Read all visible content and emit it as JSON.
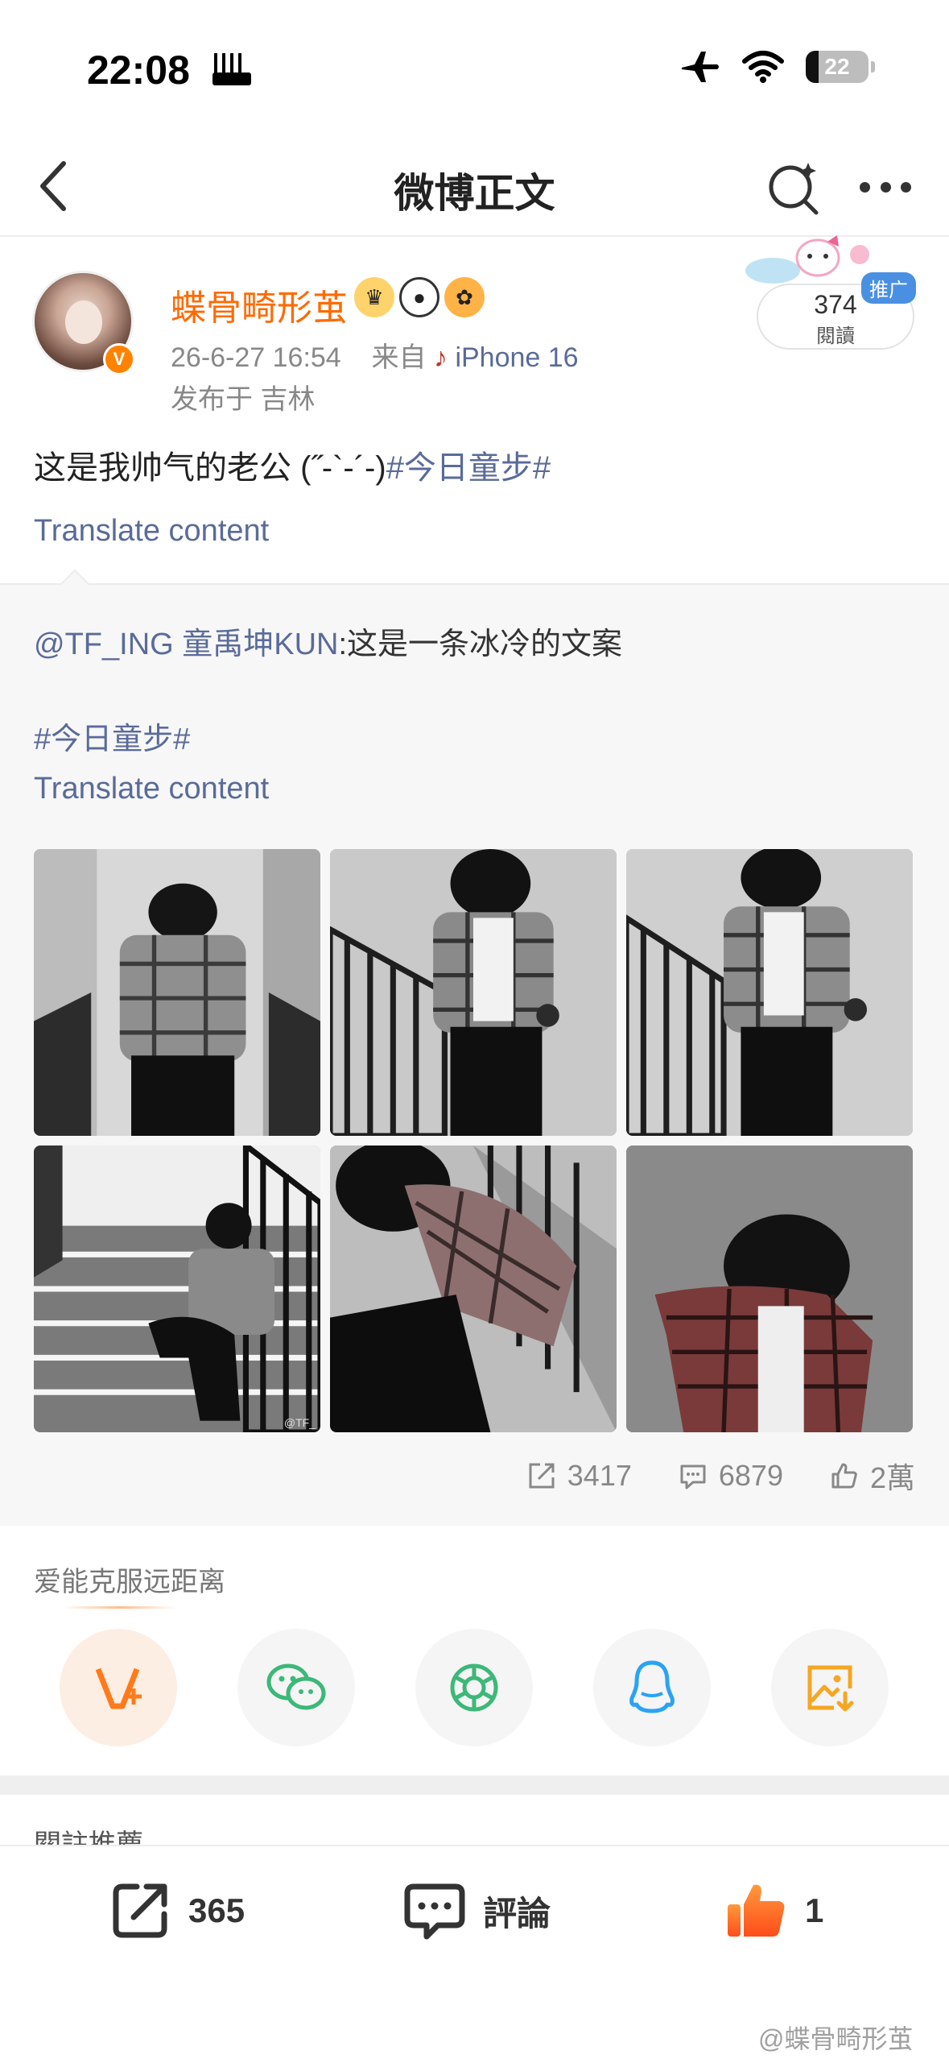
{
  "status_bar": {
    "time": "22:08",
    "battery": "22"
  },
  "nav": {
    "title": "微博正文"
  },
  "post": {
    "author": "蝶骨畸形茧",
    "date": "26-6-27 16:54",
    "source_prefix": "来自",
    "source_device": "iPhone 16",
    "location": "发布于 吉林",
    "read_count": "374",
    "read_label": "閱讀",
    "promo_tag": "推广",
    "text": "这是我帅气的老公 (˶‾᷄ ⁻̫ ‾᷅˵)",
    "text_display": "这是我帅气的老公 (˝-`-´-)",
    "hashtag": "#今日童步#",
    "translate": "Translate content"
  },
  "repost": {
    "user": "@TF_ING 童禹坤KUN",
    "text": ":这是一条冰冷的文案",
    "hashtag": "#今日童步#",
    "translate": "Translate content",
    "photo_watermark": "@TF_",
    "stats": {
      "reposts": "3417",
      "comments": "6879",
      "likes": "2萬"
    }
  },
  "share": {
    "title": "爱能克服远距离",
    "buttons": [
      "vplus-share-icon",
      "wechat-icon",
      "moments-icon",
      "qq-icon",
      "save-image-icon"
    ]
  },
  "follow_title": "關註推薦",
  "bottom_bar": {
    "reposts": "365",
    "comment_label": "評論",
    "likes": "1"
  },
  "watermark": "@蝶骨畸形茧",
  "colors": {
    "accent_orange": "#ff6a00",
    "link_blue": "#5a6b9a",
    "share_green": "#3cb878",
    "share_qq_blue": "#2aa3f5",
    "share_gold": "#f5a623"
  }
}
